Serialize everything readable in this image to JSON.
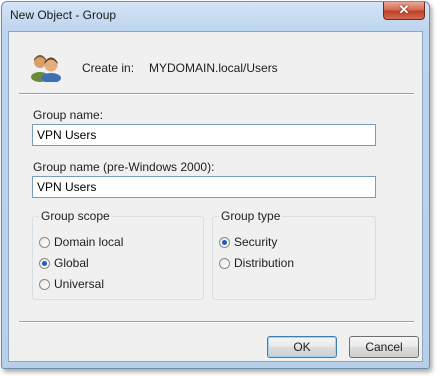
{
  "window": {
    "title": "New Object - Group",
    "close_label": "✕"
  },
  "header": {
    "create_in_label": "Create in:",
    "create_in_path": "MYDOMAIN.local/Users",
    "icon": "users-group-icon"
  },
  "fields": {
    "group_name_label": "Group name:",
    "group_name_value": "VPN Users",
    "group_name_pre2000_label": "Group name (pre-Windows 2000):",
    "group_name_pre2000_value": "VPN Users"
  },
  "group_scope": {
    "legend": "Group scope",
    "options": [
      {
        "label": "Domain local",
        "selected": false
      },
      {
        "label": "Global",
        "selected": true
      },
      {
        "label": "Universal",
        "selected": false
      }
    ]
  },
  "group_type": {
    "legend": "Group type",
    "options": [
      {
        "label": "Security",
        "selected": true
      },
      {
        "label": "Distribution",
        "selected": false
      }
    ]
  },
  "buttons": {
    "ok": "OK",
    "cancel": "Cancel"
  }
}
